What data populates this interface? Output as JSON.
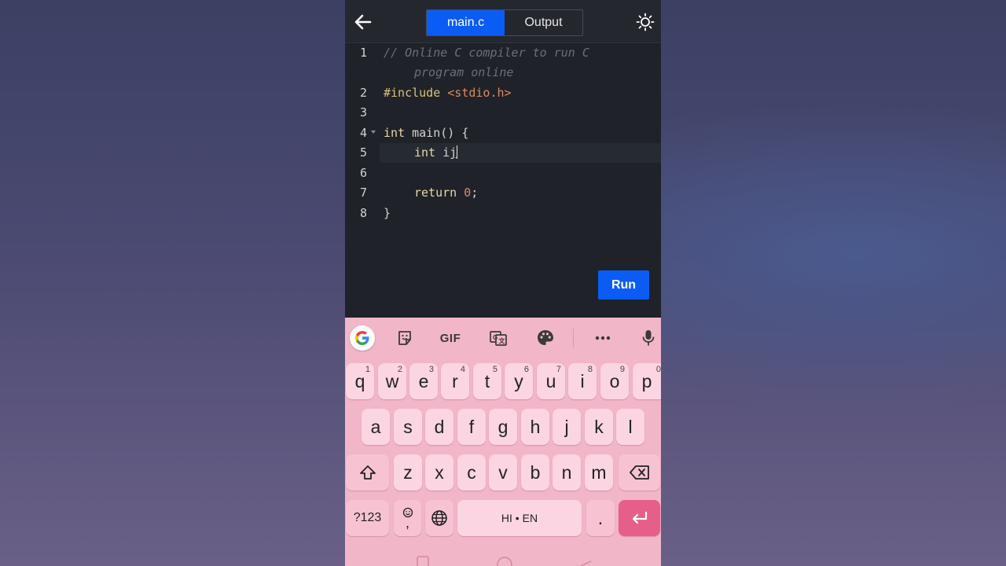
{
  "app": {
    "tabs": [
      {
        "label": "main.c",
        "active": true
      },
      {
        "label": "Output",
        "active": false
      }
    ],
    "back_icon": "arrow-left-icon",
    "theme_icon": "sun-icon",
    "run_label": "Run",
    "colors": {
      "accent": "#0a5cf5",
      "editor_bg": "#1f2228",
      "keyboard_bg": "#f2b6c9",
      "enter_key": "#e65f8a"
    }
  },
  "editor": {
    "line_numbers": [
      "1",
      "",
      "2",
      "3",
      "4",
      "5",
      "6",
      "7",
      "8"
    ],
    "comment_line1": "// Online C compiler to run C",
    "comment_line2": "program online",
    "include_kw": "#include",
    "include_file": "<stdio.h>",
    "main_kw": "int",
    "main_rest": "main() {",
    "decl_kw": "int",
    "decl_var_i": "i",
    "decl_var_j": "j",
    "return_kw": "return",
    "return_val": "0",
    "return_semi": ";",
    "close_brace": "}"
  },
  "keyboard": {
    "toolbar": [
      "google-icon",
      "sticker-icon",
      "GIF",
      "translate-icon",
      "palette-icon",
      "more-icon",
      "mic-icon"
    ],
    "gif_label": "GIF",
    "row1": [
      {
        "k": "q",
        "h": "1"
      },
      {
        "k": "w",
        "h": "2"
      },
      {
        "k": "e",
        "h": "3"
      },
      {
        "k": "r",
        "h": "4"
      },
      {
        "k": "t",
        "h": "5"
      },
      {
        "k": "y",
        "h": "6"
      },
      {
        "k": "u",
        "h": "7"
      },
      {
        "k": "i",
        "h": "8"
      },
      {
        "k": "o",
        "h": "9"
      },
      {
        "k": "p",
        "h": "0"
      }
    ],
    "row2": [
      "a",
      "s",
      "d",
      "f",
      "g",
      "h",
      "j",
      "k",
      "l"
    ],
    "row3": [
      "z",
      "x",
      "c",
      "v",
      "b",
      "n",
      "m"
    ],
    "symbols_label": "?123",
    "comma_label": ",",
    "space_label": "HI • EN",
    "period_label": ".",
    "shift_icon": "shift-icon",
    "backspace_icon": "backspace-icon",
    "globe_icon": "globe-icon",
    "enter_icon": "enter-icon",
    "emoji_icon": "emoji-icon"
  }
}
